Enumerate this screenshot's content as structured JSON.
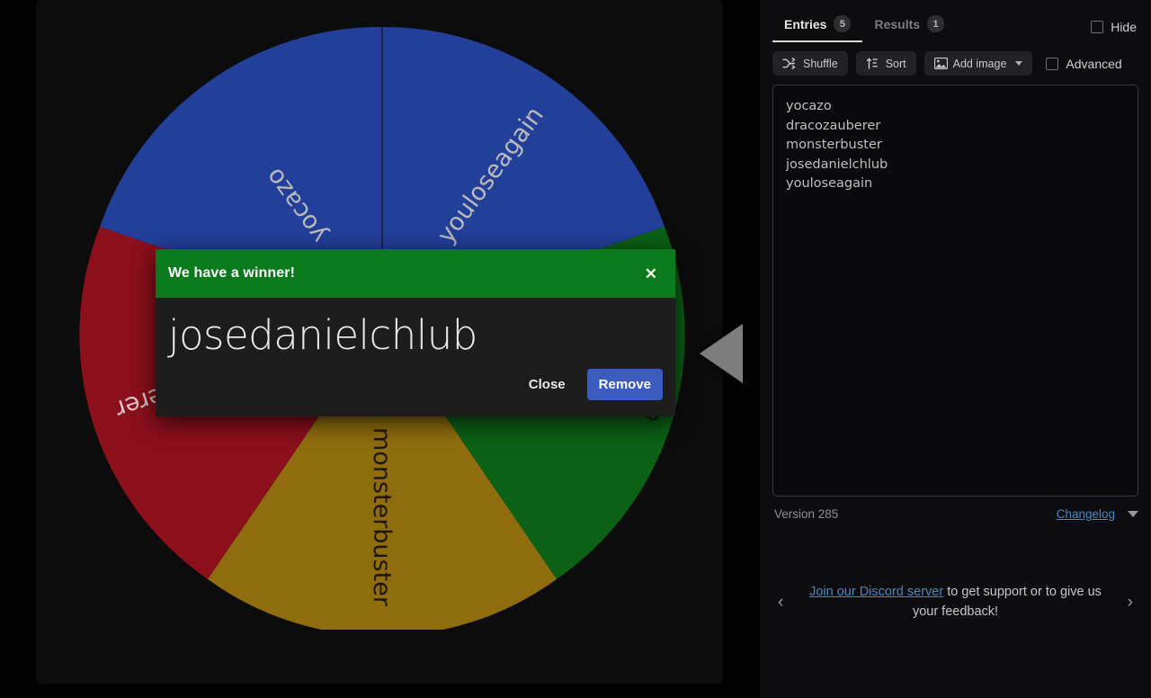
{
  "app": {
    "background": "#000000",
    "panel_bg": "#0c0c0c"
  },
  "wheel": {
    "pointer_color": "#7d7d7d",
    "segments": [
      {
        "label": "yocazo",
        "color": "#22409a",
        "text_color": "#b9b9bb"
      },
      {
        "label": "youloseagain",
        "color": "#22409a",
        "text_color": "#b9b9bb"
      },
      {
        "label": "josedanielchlub",
        "color": "#0b6115",
        "text_color": "#0d1f0d"
      },
      {
        "label": "monsterbuster",
        "color": "#8f6d0e",
        "text_color": "#1d1506"
      },
      {
        "label": "dracozauberer",
        "color": "#8c0f1c",
        "text_color": "#d9c7ca"
      }
    ]
  },
  "winner_modal": {
    "title": "We have a winner!",
    "close_icon": "close-icon",
    "winner_name": "josedanielchlub",
    "close_label": "Close",
    "remove_label": "Remove",
    "header_color": "#0b7a1d",
    "body_color": "#1d1d1d",
    "remove_button_color": "#3a5bbf"
  },
  "side_panel": {
    "tabs": [
      {
        "label": "Entries",
        "badge": "5",
        "active": true
      },
      {
        "label": "Results",
        "badge": "1",
        "active": false
      }
    ],
    "hide": {
      "label": "Hide",
      "checked": false
    },
    "toolbar": {
      "shuffle_label": "Shuffle",
      "sort_label": "Sort",
      "add_image_label": "Add image",
      "advanced_label": "Advanced",
      "shuffle_icon": "shuffle-icon",
      "sort_icon": "sort-icon",
      "add_image_icon": "image-icon",
      "dropdown_icon": "chevron-down-icon"
    },
    "entries": [
      "yocazo",
      "dracozauberer",
      "monsterbuster",
      "josedanielchlub",
      "youloseagain"
    ],
    "version_text": "Version 285",
    "changelog_label": "Changelog",
    "changelog_chevron_icon": "chevron-down-icon",
    "promo": {
      "prev_icon": "‹",
      "next_icon": "›",
      "link_text": "Join our Discord server",
      "rest_text": " to get support or to give us your feedback!"
    }
  }
}
